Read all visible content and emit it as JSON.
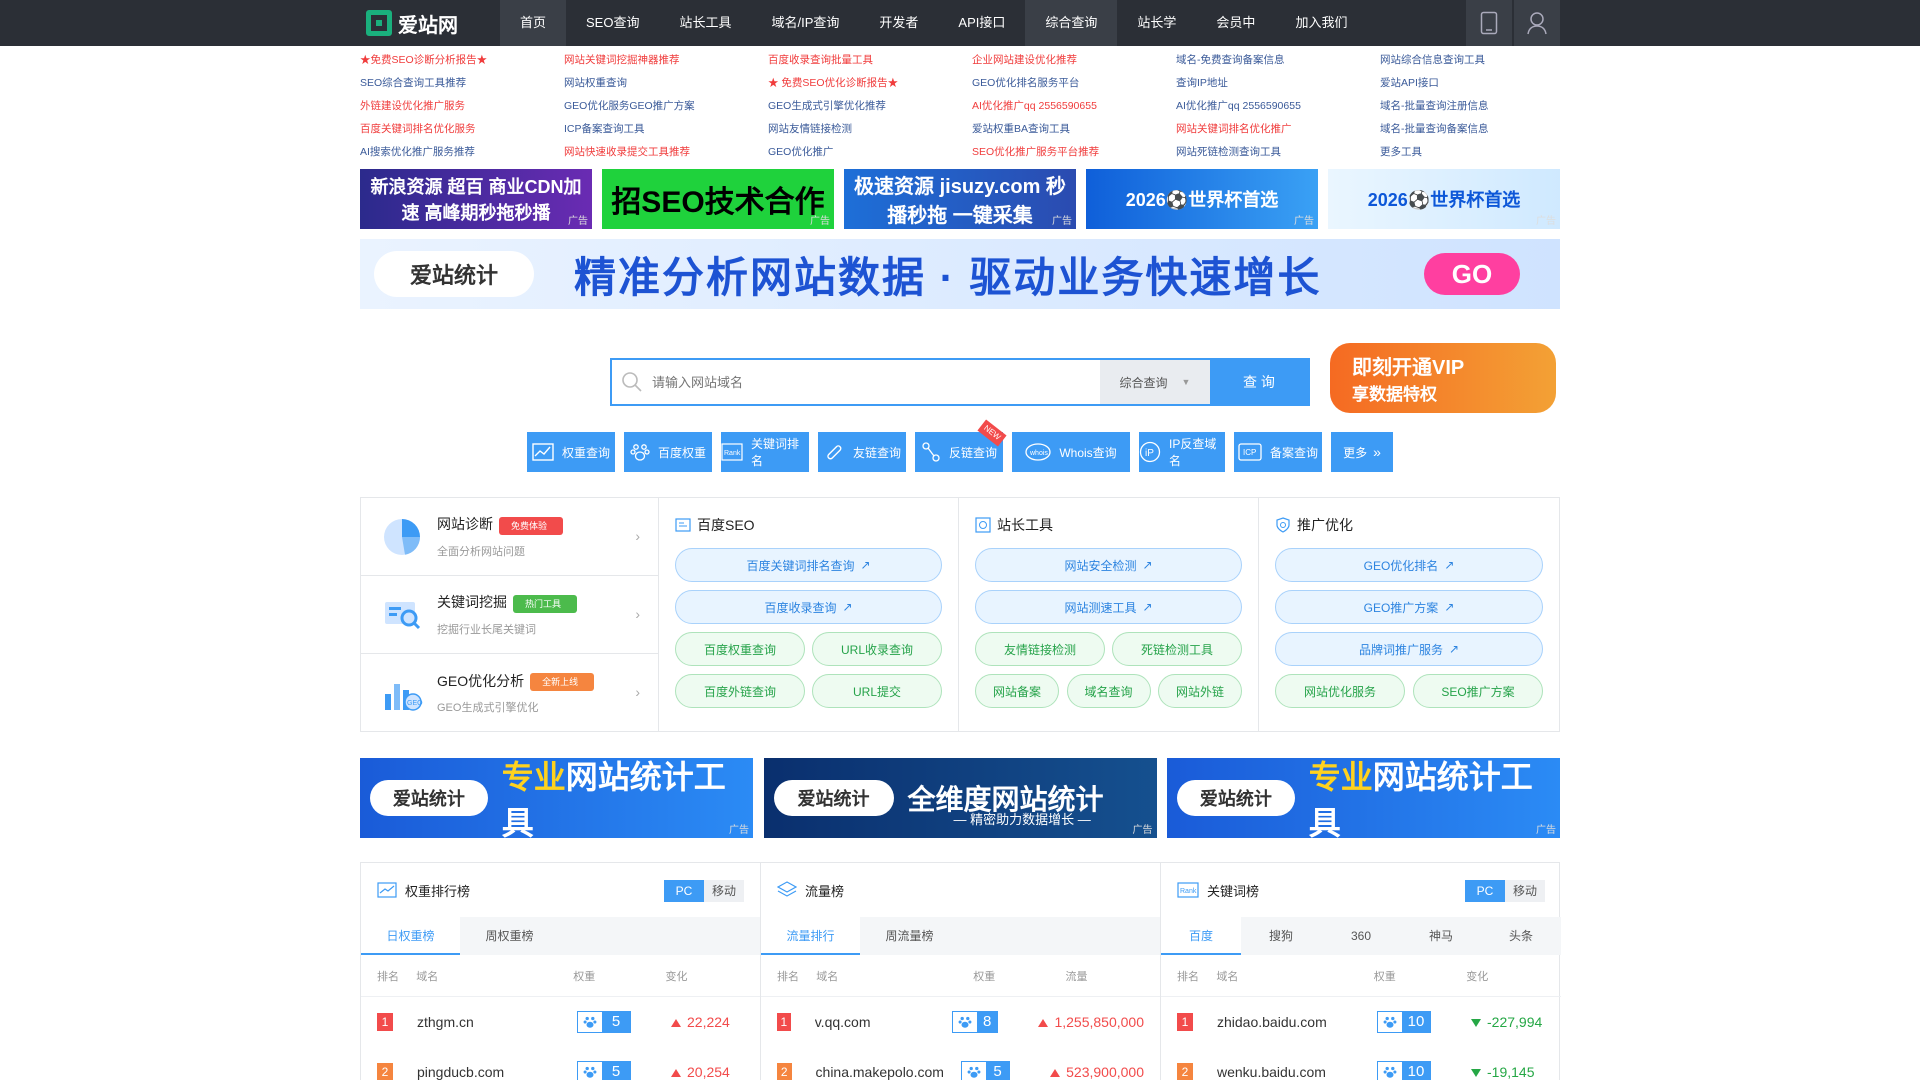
{
  "nav": {
    "logo_text": "爱站网",
    "items": [
      {
        "label": "首页",
        "active": true
      },
      {
        "label": "SEO查询"
      },
      {
        "label": "站长工具"
      },
      {
        "label": "域名/IP查询"
      },
      {
        "label": "开发者",
        "dot": true
      },
      {
        "label": "API接口"
      },
      {
        "label": "综合查询"
      },
      {
        "label": "站长学"
      },
      {
        "label": "会员中"
      },
      {
        "label": "加入我们"
      }
    ],
    "icons": [
      "tablet-icon",
      "user-icon"
    ]
  },
  "links": [
    {
      "text": "★免费SEO诊断分析报告★",
      "red": true
    },
    {
      "text": "网站关键词挖掘神器推荐",
      "red": true
    },
    {
      "text": "百度收录查询批量工具",
      "red": true
    },
    {
      "text": "企业网站建设优化推荐",
      "red": true
    },
    {
      "text": "域名-免费查询备案信息",
      "red": false
    },
    {
      "text": "网站综合信息查询工具",
      "red": false
    },
    {
      "text": "SEO综合查询工具推荐",
      "red": false
    },
    {
      "text": "网站权重查询",
      "red": false
    },
    {
      "text": "★ 免费SEO优化诊断报告★",
      "red": true
    },
    {
      "text": "GEO优化排名服务平台",
      "red": false
    },
    {
      "text": "查询IP地址",
      "red": false
    },
    {
      "text": "爱站API接口",
      "red": false
    },
    {
      "text": "外链建设优化推广服务",
      "red": true
    },
    {
      "text": "GEO优化服务GEO推广方案",
      "red": false
    },
    {
      "text": "GEO生成式引擎优化推荐",
      "red": false
    },
    {
      "text": "AI优化推广qq 2556590655",
      "red": true
    },
    {
      "text": "AI优化推广qq 2556590655",
      "red": false
    },
    {
      "text": "域名-批量查询注册信息",
      "red": false
    },
    {
      "text": "百度关键词排名优化服务",
      "red": true
    },
    {
      "text": "ICP备案查询工具",
      "red": false
    },
    {
      "text": "网站友情链接检测",
      "red": false
    },
    {
      "text": "爱站权重BA查询工具",
      "red": false
    },
    {
      "text": "网站关键词排名优化推广",
      "red": true
    },
    {
      "text": "域名-批量查询备案信息",
      "red": false
    },
    {
      "text": "AI搜索优化推广服务推荐",
      "red": false
    },
    {
      "text": "网站快速收录提交工具推荐",
      "red": true
    },
    {
      "text": "GEO优化推广",
      "red": false
    },
    {
      "text": "SEO优化推广服务平台推荐",
      "red": true
    },
    {
      "text": "网站死链检测查询工具",
      "red": false
    },
    {
      "text": "更多工具",
      "red": false
    }
  ],
  "ads_small": [
    {
      "text": "新浪资源 超百 商业CDN加速 高峰期秒拖秒播",
      "tag": "广告"
    },
    {
      "text": "招SEO技术合作",
      "tag": "广告"
    },
    {
      "text": "极速资源 jisuzy.com 秒播秒拖 一键采集",
      "tag": "广告"
    },
    {
      "text": "2026⚽世界杯首选",
      "tag": "广告"
    },
    {
      "text": "2026⚽世界杯首选",
      "tag": "广告"
    }
  ],
  "banner": {
    "logo": "爱站统计",
    "text": "精准分析网站数据 · 驱动业务快速增长",
    "go": "GO"
  },
  "search": {
    "placeholder": "请输入网站域名",
    "select": "综合查询",
    "button": "查 询"
  },
  "vip": {
    "line1": "即刻开通VIP",
    "line2": "享数据特权"
  },
  "tools": [
    {
      "label": "权重查询",
      "icon": "chart-icon"
    },
    {
      "label": "百度权重",
      "icon": "paw-icon"
    },
    {
      "label": "关键词排名",
      "icon": "rank-icon"
    },
    {
      "label": "友链查询",
      "icon": "link-icon"
    },
    {
      "label": "反链查询",
      "icon": "backlink-icon",
      "new": "NEW"
    },
    {
      "label": "Whois查询",
      "icon": "whois-icon"
    },
    {
      "label": "IP反查域名",
      "icon": "ip-icon"
    },
    {
      "label": "备案查询",
      "icon": "icp-icon"
    },
    {
      "label": "更多",
      "icon": "more-icon"
    }
  ],
  "features": {
    "left": [
      {
        "title": "网站诊断",
        "badge": "免费体验",
        "badge_color": "#f24b4b",
        "sub": "全面分析网站问题"
      },
      {
        "title": "关键词挖掘",
        "badge": "热门工具",
        "badge_color": "#4cbb4c",
        "sub": "挖掘行业长尾关键词"
      },
      {
        "title": "GEO优化分析",
        "badge": "全新上线",
        "badge_color": "#f5853f",
        "sub": "GEO生成式引擎优化"
      }
    ],
    "cols": [
      {
        "title": "百度SEO",
        "blue": [
          "百度关键词排名查询",
          "百度收录查询"
        ],
        "green": [
          "百度权重查询",
          "URL收录查询",
          "百度外链查询",
          "URL提交"
        ]
      },
      {
        "title": "站长工具",
        "blue": [
          "网站安全检测",
          "网站测速工具"
        ],
        "green": [
          "友情链接检测",
          "死链检测工具",
          "网站备案",
          "域名查询",
          "网站外链"
        ]
      },
      {
        "title": "推广优化",
        "blue": [
          "GEO优化排名",
          "GEO推广方案",
          "品牌词推广服务"
        ],
        "green": [
          "网站优化服务",
          "SEO推广方案"
        ]
      }
    ]
  },
  "ads_bottom": [
    {
      "logo": "爱站统计",
      "pre": "专业",
      "text": "网站统计工具",
      "tag": "广告"
    },
    {
      "logo": "爱站统计",
      "pre": "",
      "text": "全维度网站统计",
      "sub": "— 精密助力数据增长 —",
      "tag": "广告"
    },
    {
      "logo": "爱站统计",
      "pre": "专业",
      "text": "网站统计工具",
      "tag": "广告"
    }
  ],
  "ranks": [
    {
      "title": "权重排行榜",
      "icon": "trend-icon",
      "toggle": [
        "PC",
        "移动"
      ],
      "tabs": [
        "日权重榜",
        "周权重榜"
      ],
      "cols": [
        "排名",
        "域名",
        "权重",
        "变化"
      ],
      "rows": [
        {
          "n": "1",
          "domain": "zthgm.cn",
          "br": "5",
          "change": "22,224",
          "dir": "up"
        },
        {
          "n": "2",
          "domain": "pingducb.com",
          "br": "5",
          "change": "20,254",
          "dir": "up"
        }
      ]
    },
    {
      "title": "流量榜",
      "icon": "layers-icon",
      "toggle": [],
      "tabs": [
        "流量排行",
        "周流量榜"
      ],
      "cols": [
        "排名",
        "域名",
        "权重",
        "流量"
      ],
      "rows": [
        {
          "n": "1",
          "domain": "v.qq.com",
          "br": "8",
          "change": "1,255,850,000",
          "dir": "up"
        },
        {
          "n": "2",
          "domain": "china.makepolo.com",
          "br": "5",
          "change": "523,900,000",
          "dir": "up"
        }
      ]
    },
    {
      "title": "关键词榜",
      "icon": "rank-icon",
      "toggle": [
        "PC",
        "移动"
      ],
      "tabs": [
        "百度",
        "搜狗",
        "360",
        "神马",
        "头条"
      ],
      "cols": [
        "排名",
        "域名",
        "权重",
        "变化"
      ],
      "rows": [
        {
          "n": "1",
          "domain": "zhidao.baidu.com",
          "br": "10",
          "change": "-227,994",
          "dir": "down"
        },
        {
          "n": "2",
          "domain": "wenku.baidu.com",
          "br": "10",
          "change": "-19,145",
          "dir": "down"
        }
      ]
    }
  ]
}
